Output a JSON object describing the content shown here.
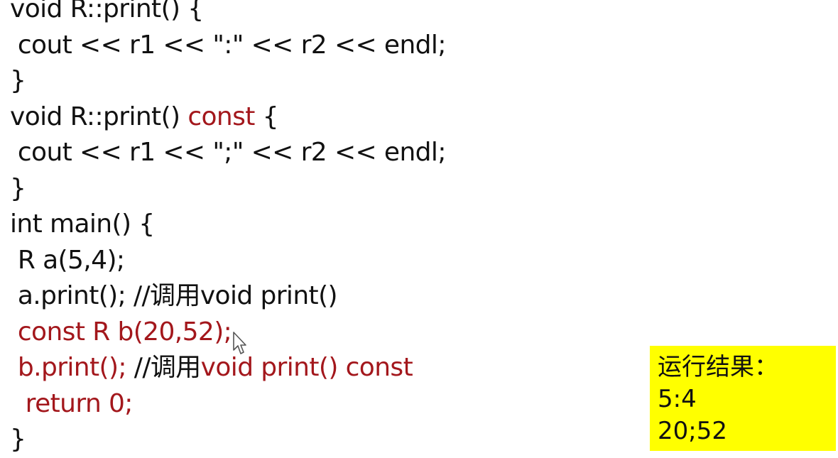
{
  "colors": {
    "keyword_red": "#a3171c",
    "text": "#111111",
    "result_background": "#ffff00"
  },
  "code": [
    [
      {
        "t": "void R::print() {",
        "c": "black"
      }
    ],
    [
      {
        "t": " cout << r1 << \":\" << r2 << endl;",
        "c": "black"
      }
    ],
    [
      {
        "t": "}",
        "c": "black"
      }
    ],
    [
      {
        "t": "void R::print() ",
        "c": "black"
      },
      {
        "t": "const",
        "c": "red"
      },
      {
        "t": " {",
        "c": "black"
      }
    ],
    [
      {
        "t": " cout << r1 << \";\" << r2 << endl;",
        "c": "black"
      }
    ],
    [
      {
        "t": "}",
        "c": "black"
      }
    ],
    [
      {
        "t": "int main() {",
        "c": "black"
      }
    ],
    [
      {
        "t": " R a(5,4);",
        "c": "black"
      }
    ],
    [
      {
        "t": " a.print(); //调用void print()",
        "c": "black"
      }
    ],
    [
      {
        "t": " const R b(20,52);",
        "c": "red"
      }
    ],
    [
      {
        "t": " b.print();",
        "c": "red"
      },
      {
        "t": " //调用",
        "c": "black"
      },
      {
        "t": "void print() const",
        "c": "red"
      }
    ],
    [
      {
        "t": "  return 0;",
        "c": "red"
      }
    ],
    [
      {
        "t": "}",
        "c": "black"
      }
    ]
  ],
  "result": {
    "title": "运行结果：",
    "lines": [
      "5:4",
      "20;52"
    ]
  },
  "icons": {
    "cursor": "mouse-pointer-icon"
  }
}
